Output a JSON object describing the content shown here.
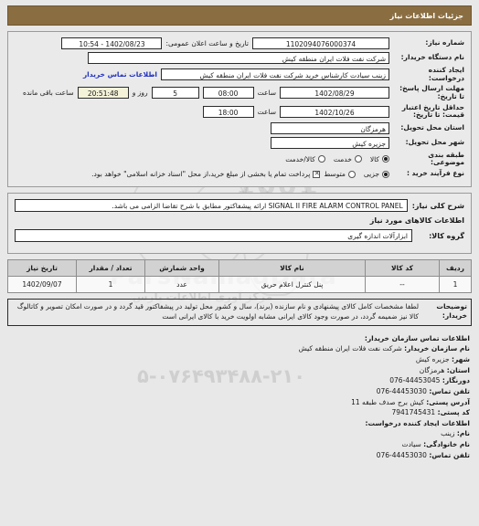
{
  "header": {
    "title": "جزئیات اطلاعات نیاز"
  },
  "form": {
    "need_number_label": "شماره نیاز:",
    "need_number_value": "1102094076000374",
    "public_announce_label": "تاریخ و ساعت اعلان عمومی:",
    "public_announce_value": "1402/08/23 - 10:54",
    "buyer_org_label": "نام دستگاه خریدار:",
    "buyer_org_value": "شرکت نفت فلات ایران منطقه کیش",
    "creator_label": "ایجاد کننده درخواست:",
    "creator_value": "زینب سیادت کارشناس خرید  شرکت نفت فلات ایران منطقه کیش",
    "contact_link": "اطلاعات تماس خریدار",
    "deadline_label": "مهلت ارسال پاسخ: تا تاریخ:",
    "deadline_date": "1402/08/29",
    "deadline_time_label": "ساعت",
    "deadline_time": "08:00",
    "remaining_days": "5",
    "remaining_days_label": "روز و",
    "remaining_countdown": "20:51:48",
    "remaining_suffix": "ساعت باقی مانده",
    "price_validity_label": "حداقل تاریخ اعتبار قیمت: تا تاریخ:",
    "price_validity_date": "1402/10/26",
    "price_validity_time_label": "ساعت",
    "price_validity_time": "18:00",
    "province_label": "استان محل تحویل:",
    "province_value": "هرمزگان",
    "city_label": "شهر محل تحویل:",
    "city_value": "جزیره کیش",
    "category_label": "طبقه بندی موضوعی:",
    "category_options": [
      {
        "label": "کالا",
        "selected": true
      },
      {
        "label": "خدمت",
        "selected": false
      },
      {
        "label": "کالا/خدمت",
        "selected": false
      }
    ],
    "process_label": "نوع فرآیند خرید :",
    "process_options": [
      {
        "label": "جزیی",
        "selected": true
      },
      {
        "label": "متوسط",
        "selected": false
      }
    ],
    "treasury_checkbox_checked": true,
    "treasury_note": "پرداخت تمام یا بخشی از مبلغ خرید،از محل \"اسناد خزانه اسلامی\" خواهد بود."
  },
  "description": {
    "summary_label": "شرح کلی نیاز:",
    "summary_value": "SIGNAL II FIRE ALARM CONTROL PANEL ارائه پیشفاکتور مطابق با شرح تقاضا الزامی می باشد.",
    "goods_info_title": "اطلاعات کالاهای مورد نیاز",
    "group_label": "گروه کالا:",
    "group_value": "ابزارآلات اندازه گیری"
  },
  "table": {
    "columns": [
      "ردیف",
      "کد کالا",
      "نام کالا",
      "واحد شمارش",
      "تعداد / مقدار",
      "تاریخ نیاز"
    ],
    "rows": [
      {
        "row": "1",
        "code": "--",
        "name": "پنل کنترل اعلام حریق",
        "unit": "عدد",
        "quantity": "1",
        "need_date": "1402/09/07"
      }
    ]
  },
  "notes": {
    "label": "توضیحات خریدار:",
    "text": "لطفا مشخصات کامل کالای پیشنهادی و نام سازنده (برند)، سال و کشور محل تولید در پیشفاکتور قید گردد و در صورت امکان تصویر و کاتالوگ کالا نیز ضمیمه گردد، در صورت وجود کالای ایرانی مشابه اولویت خرید با کالای ایرانی است"
  },
  "contact": {
    "org_section_title": "اطلاعات تماس سازمان خریدار:",
    "org_name_label": "نام سازمان خریدار:",
    "org_name_value": "شرکت نفت فلات ایران منطقه کیش",
    "city_label": "شهر:",
    "city_value": "جزیره کیش",
    "province_label": "استان:",
    "province_value": "هرمزگان",
    "fax_label": "دورنگار:",
    "fax_value": "44453045-076",
    "phone_label": "تلفن تماس:",
    "phone_value": "44453030-076",
    "address_label": "آدرس پستی:",
    "address_value": "کیش برج صدف طبقه 11",
    "postal_label": "کد پستی:",
    "postal_value": "7941745431",
    "creator_section_title": "اطلاعات ایجاد کننده درخواست:",
    "first_name_label": "نام:",
    "first_name_value": "زینب",
    "last_name_label": "نام خانوادگی:",
    "last_name_value": "سیادت",
    "creator_phone_label": "تلفن تماس:",
    "creator_phone_value": "44453030-076"
  },
  "watermark": {
    "brand": "ParsNamadData",
    "sub": "مرکز آوری اطلاعات پارس",
    "phone": "۵-۰۷۶۴۹۳۴۸۸-۲۱۰",
    "digits_a": "0101",
    "digits_b": "1001",
    "digit_c": "1"
  }
}
